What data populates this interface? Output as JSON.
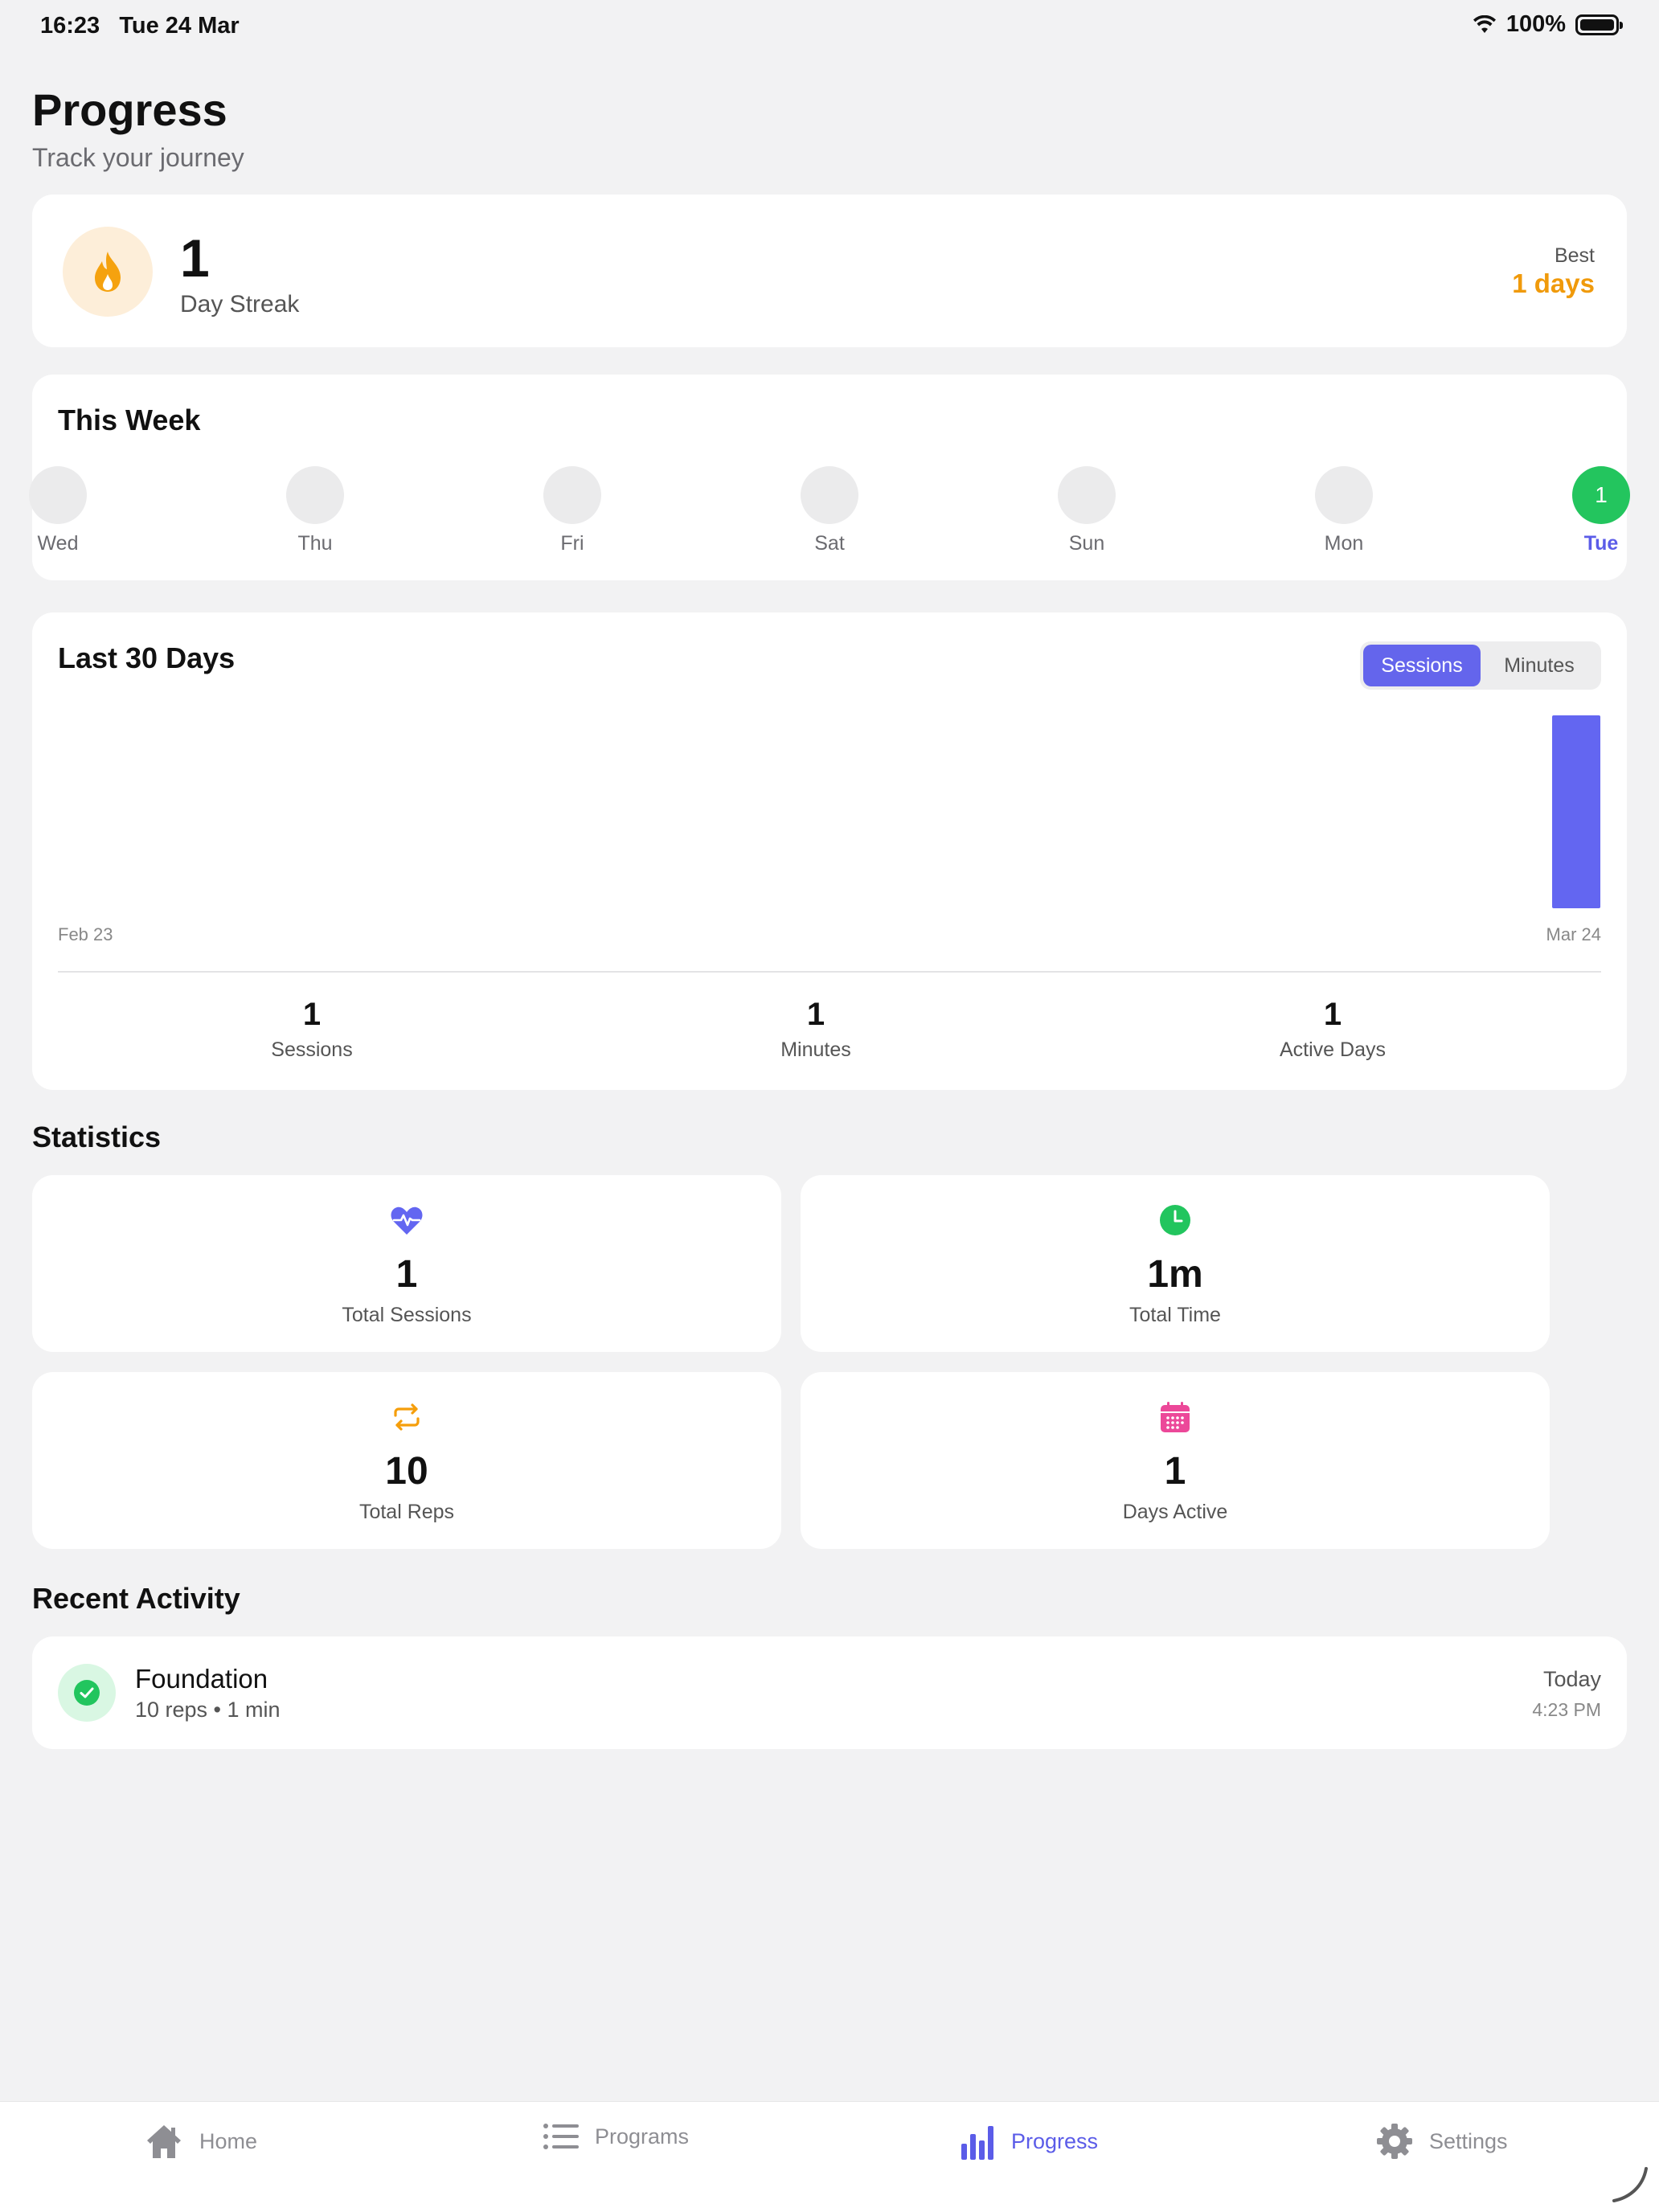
{
  "status_bar": {
    "time": "16:23",
    "date": "Tue 24 Mar",
    "battery": "100%"
  },
  "header": {
    "title": "Progress",
    "subtitle": "Track your journey"
  },
  "streak": {
    "count": "1",
    "label": "Day Streak",
    "best_label": "Best",
    "best_value": "1 days",
    "icon": "flame-icon"
  },
  "this_week": {
    "title": "This Week",
    "days": [
      {
        "label": "Wed",
        "value": "",
        "done": false
      },
      {
        "label": "Thu",
        "value": "",
        "done": false
      },
      {
        "label": "Fri",
        "value": "",
        "done": false
      },
      {
        "label": "Sat",
        "value": "",
        "done": false
      },
      {
        "label": "Sun",
        "value": "",
        "done": false
      },
      {
        "label": "Mon",
        "value": "",
        "done": false
      },
      {
        "label": "Tue",
        "value": "1",
        "done": true
      }
    ]
  },
  "last30": {
    "title": "Last 30 Days",
    "toggle": {
      "options": [
        "Sessions",
        "Minutes"
      ],
      "selected": "Sessions"
    },
    "start_label": "Feb 23",
    "end_label": "Mar 24",
    "summary": [
      {
        "value": "1",
        "label": "Sessions"
      },
      {
        "value": "1",
        "label": "Minutes"
      },
      {
        "value": "1",
        "label": "Active Days"
      }
    ]
  },
  "chart_data": {
    "type": "bar",
    "title": "Last 30 Days",
    "x_start": "Feb 23",
    "x_end": "Mar 24",
    "metric": "Sessions",
    "values": [
      0,
      0,
      0,
      0,
      0,
      0,
      0,
      0,
      0,
      0,
      0,
      0,
      0,
      0,
      0,
      0,
      0,
      0,
      0,
      0,
      0,
      0,
      0,
      0,
      0,
      0,
      0,
      0,
      0,
      0,
      1
    ],
    "bar_color": "#6366f1"
  },
  "statistics": {
    "title": "Statistics",
    "items": [
      {
        "value": "1",
        "label": "Total Sessions",
        "icon": "heart-pulse-icon",
        "color": "#6366f1"
      },
      {
        "value": "1m",
        "label": "Total Time",
        "icon": "clock-icon",
        "color": "#22c55e"
      },
      {
        "value": "10",
        "label": "Total Reps",
        "icon": "repeat-icon",
        "color": "#f59e0b"
      },
      {
        "value": "1",
        "label": "Days Active",
        "icon": "calendar-icon",
        "color": "#ec4899"
      }
    ]
  },
  "recent": {
    "title": "Recent Activity",
    "items": [
      {
        "name": "Foundation",
        "detail": "10 reps • 1 min",
        "day": "Today",
        "time": "4:23 PM"
      }
    ]
  },
  "tabs": [
    {
      "label": "Home",
      "icon": "home-icon"
    },
    {
      "label": "Programs",
      "icon": "list-icon"
    },
    {
      "label": "Progress",
      "icon": "bar-chart-icon"
    },
    {
      "label": "Settings",
      "icon": "gear-icon"
    }
  ],
  "colors": {
    "accent": "#6366f1",
    "success": "#22c55e",
    "streak": "#f59e0b"
  }
}
